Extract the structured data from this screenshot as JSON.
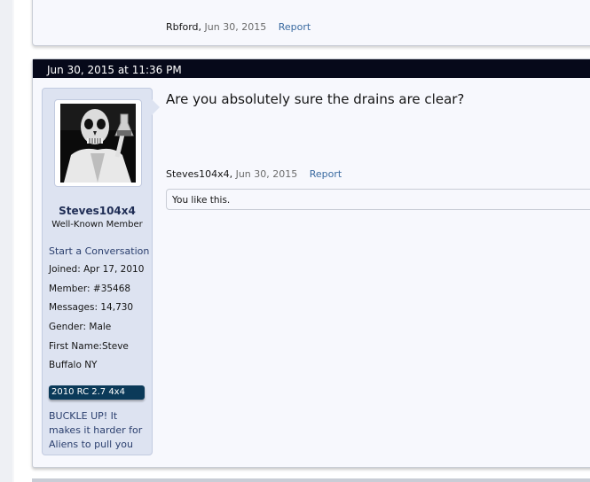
{
  "prev_post": {
    "author": "Rbford",
    "date": "Jun 30, 2015",
    "report_label": "Report"
  },
  "post": {
    "timestamp": "Jun 30, 2015 at 11:36 PM",
    "message": "Are you absolutely sure the drains are clear?",
    "author": "Steves104x4",
    "date": "Jun 30, 2015",
    "report_label": "Report",
    "likes_text": "You like this."
  },
  "user": {
    "username": "Steves104x4",
    "title": "Well-Known Member",
    "start_conversation": "Start a Conversation",
    "joined_label": "Joined:",
    "joined": "Apr 17, 2010",
    "member_label": "Member:",
    "member": "#35468",
    "messages_label": "Messages:",
    "messages": "14,730",
    "gender_label": "Gender:",
    "gender": "Male",
    "first_name_label": "First Name:",
    "first_name": "Steve",
    "location": "Buffalo NY",
    "vehicle_badge": "2010 RC 2.7 4x4",
    "signature": "BUCKLE UP! It makes it harder for Aliens to pull you"
  },
  "colors": {
    "header_bg": "#06091a",
    "panel_bg": "#dde3f1",
    "link": "#3a6aa0",
    "badge_bg": "#0b3a59"
  }
}
